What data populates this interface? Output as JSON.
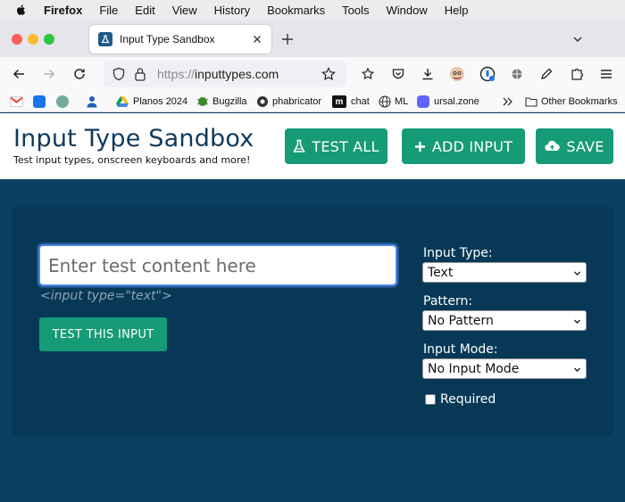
{
  "menubar": {
    "app": "Firefox",
    "items": [
      "File",
      "Edit",
      "View",
      "History",
      "Bookmarks",
      "Tools",
      "Window",
      "Help"
    ]
  },
  "browser": {
    "tab_title": "Input Type Sandbox",
    "url_scheme": "https://",
    "url_host": "inputtypes.com"
  },
  "bookmarks": {
    "planos": "Planos 2024",
    "bugzilla": "Bugzilla",
    "phabricator": "phabricator",
    "chat": "chat",
    "ml": "ML",
    "ursal": "ursal.zone",
    "other": "Other Bookmarks"
  },
  "header": {
    "title": "Input Type Sandbox",
    "subtitle": "Test input types, onscreen keyboards and more!",
    "test_all": "TEST ALL",
    "add_input": "ADD INPUT",
    "save": "SAVE"
  },
  "main": {
    "input_placeholder": "Enter test content here",
    "input_caption": "<input type=\"text\">",
    "test_button": "TEST THIS INPUT",
    "input_type_label": "Input Type:",
    "input_type_value": "Text",
    "pattern_label": "Pattern:",
    "pattern_value": "No Pattern",
    "input_mode_label": "Input Mode:",
    "input_mode_value": "No Input Mode",
    "required_label": "Required"
  },
  "colors": {
    "page_bg": "#0a3f62",
    "panel_bg": "#073957",
    "accent_green": "#169b77",
    "title_navy": "#113a5c"
  }
}
